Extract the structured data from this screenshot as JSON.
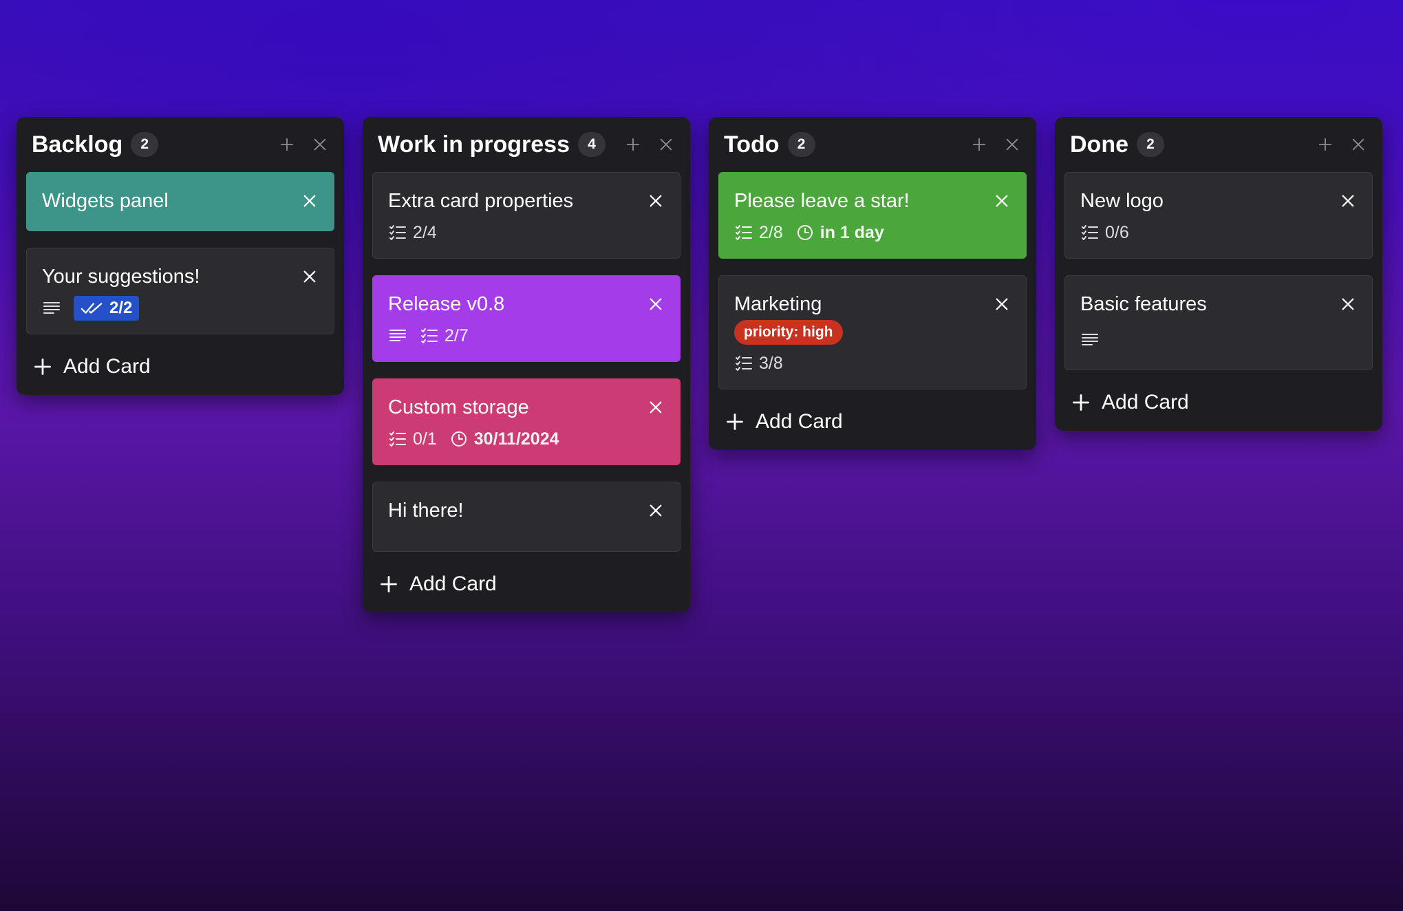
{
  "board": {
    "columns": [
      {
        "title": "Backlog",
        "count": "2",
        "add_card_label": "Add Card",
        "cards": [
          {
            "title": "Widgets panel",
            "color": "#3d958a"
          },
          {
            "title": "Your suggestions!",
            "has_description": true,
            "checklist": "2/2",
            "checklist_complete": true
          }
        ]
      },
      {
        "title": "Work in progress",
        "count": "4",
        "add_card_label": "Add Card",
        "cards": [
          {
            "title": "Extra card properties",
            "checklist": "2/4"
          },
          {
            "title": "Release v0.8",
            "color": "#a53cea",
            "has_description": true,
            "checklist": "2/7"
          },
          {
            "title": "Custom storage",
            "color": "#cb3c74",
            "checklist": "0/1",
            "due": "30/11/2024"
          },
          {
            "title": "Hi there!"
          }
        ]
      },
      {
        "title": "Todo",
        "count": "2",
        "add_card_label": "Add Card",
        "cards": [
          {
            "title": "Please leave a star!",
            "color": "#4ba73c",
            "checklist": "2/8",
            "due": "in 1 day"
          },
          {
            "title": "Marketing",
            "label": "priority: high",
            "label_color": "#c8321f",
            "checklist": "3/8"
          }
        ]
      },
      {
        "title": "Done",
        "count": "2",
        "add_card_label": "Add Card",
        "cards": [
          {
            "title": "New logo",
            "checklist": "0/6"
          },
          {
            "title": "Basic features",
            "has_description": true
          }
        ]
      }
    ]
  },
  "icons": {
    "add": "plus-icon",
    "remove": "close-icon",
    "description": "description-lines-icon",
    "checklist": "checklist-icon",
    "checklist_done": "double-check-icon",
    "due": "clock-icon"
  }
}
